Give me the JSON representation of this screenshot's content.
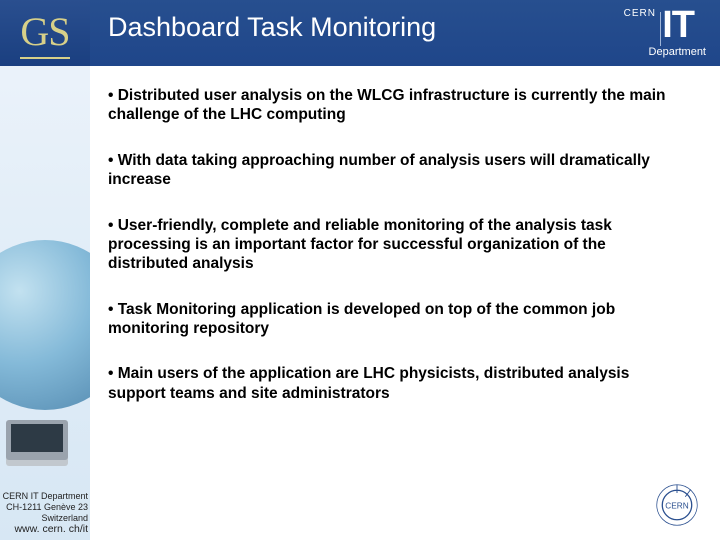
{
  "header": {
    "gs": "GS",
    "title": "Dashboard Task Monitoring",
    "it_logo": {
      "brand": "CERN",
      "unit": "IT",
      "dept": "Department"
    }
  },
  "bullets": [
    "• Distributed user analysis on the WLCG infrastructure is currently the main challenge of the LHC computing",
    "• With data taking approaching number of analysis users will dramatically increase",
    "• User-friendly, complete and reliable monitoring of the analysis task processing is an important factor for successful organization of the distributed analysis",
    "• Task Monitoring application is developed on top of the common job monitoring repository",
    "• Main users of the application are LHC physicists, distributed analysis support teams and site administrators"
  ],
  "footer": {
    "line1": "CERN IT Department",
    "line2": "CH-1211 Genève 23",
    "line3": "Switzerland",
    "url": "www. cern. ch/it"
  }
}
